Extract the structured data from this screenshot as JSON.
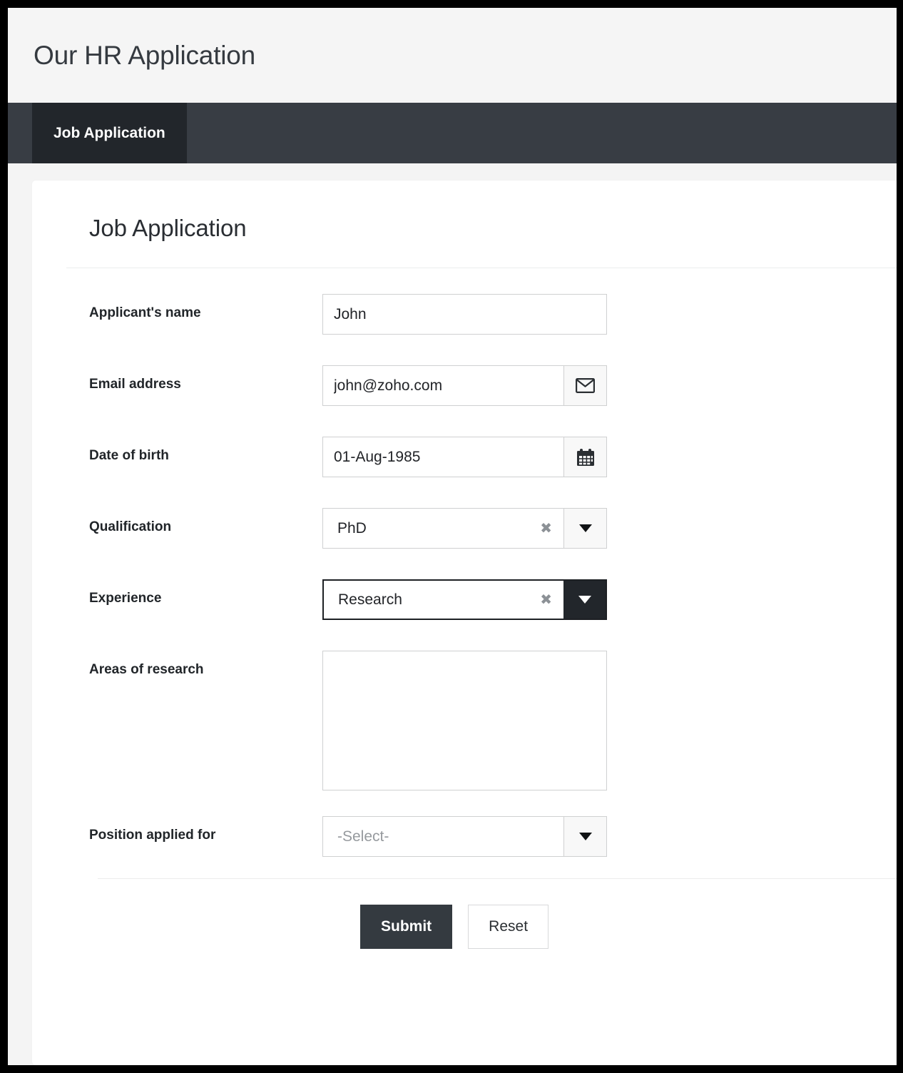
{
  "app": {
    "title": "Our HR Application",
    "background_color": "#f4f4f4",
    "header_background": "#f5f5f5",
    "navbar_color": "#383d44",
    "active_tab_color": "#22262b"
  },
  "navbar": {
    "tabs": [
      {
        "label": "Job Application",
        "active": true
      }
    ]
  },
  "card": {
    "title": "Job Application"
  },
  "form": {
    "fields": {
      "applicant_name": {
        "label": "Applicant's name",
        "value": "John",
        "placeholder": ""
      },
      "email_address": {
        "label": "Email address",
        "value": "john@zoho.com",
        "placeholder": "",
        "addon_icon": "envelope-icon"
      },
      "date_of_birth": {
        "label": "Date of birth",
        "value": "01-Aug-1985",
        "placeholder": "",
        "addon_icon": "calendar-icon"
      },
      "qualification": {
        "label": "Qualification",
        "value": "PhD",
        "clear_glyph": "✖",
        "arrow_icon": "chevron-down-icon",
        "focused": false
      },
      "experience": {
        "label": "Experience",
        "value": "Research",
        "clear_glyph": "✖",
        "arrow_icon": "chevron-down-icon",
        "focused": true
      },
      "areas_of_research": {
        "label": "Areas of research",
        "value": "",
        "placeholder": ""
      },
      "position_applied_for": {
        "label": "Position applied for",
        "value": "-Select-",
        "is_placeholder": true,
        "arrow_icon": "chevron-down-icon",
        "focused": false
      }
    }
  },
  "footer": {
    "submit_label": "Submit",
    "reset_label": "Reset",
    "submit_color": "#343a40"
  }
}
